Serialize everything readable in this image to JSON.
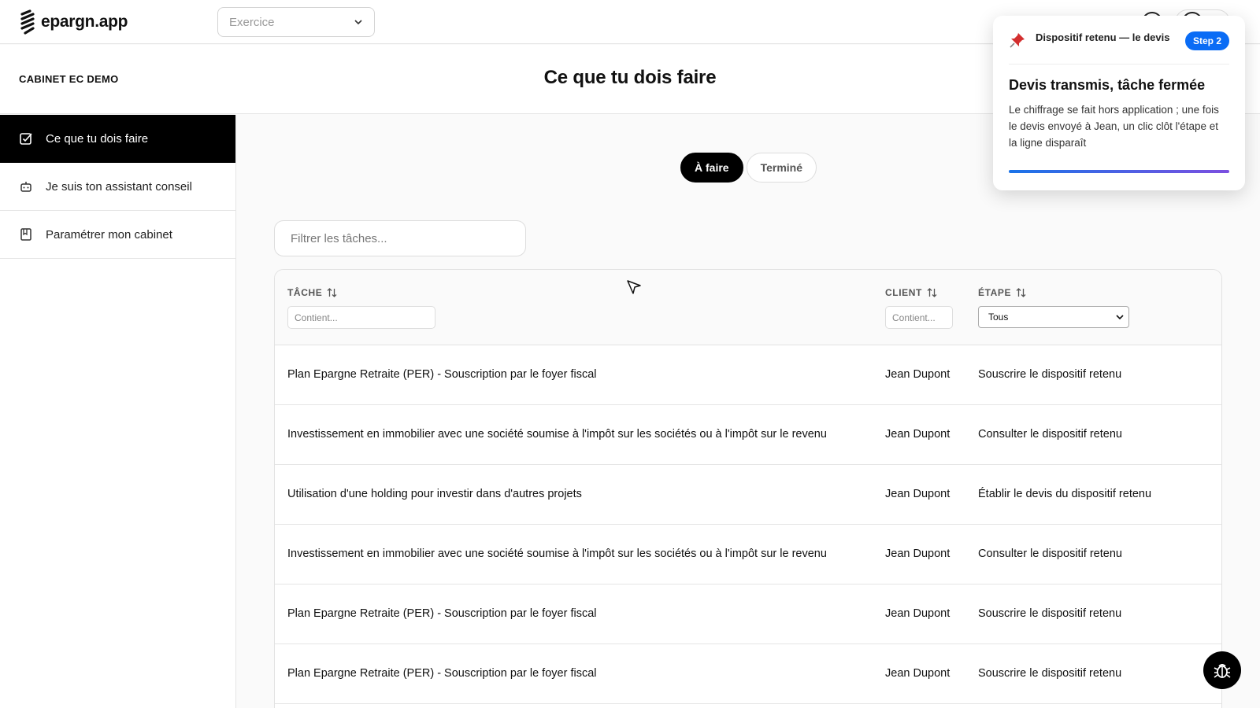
{
  "app": {
    "logo_text": "epargn.app",
    "exercise_placeholder": "Exercice"
  },
  "header": {
    "firm_name": "CABINET EC DEMO",
    "page_title": "Ce que tu dois faire"
  },
  "sidebar": {
    "items": [
      {
        "label": "Ce que tu dois faire",
        "icon": "checkbox-icon",
        "active": true
      },
      {
        "label": "Je suis ton assistant conseil",
        "icon": "robot-icon",
        "active": false
      },
      {
        "label": "Paramétrer mon cabinet",
        "icon": "book-icon",
        "active": false
      }
    ]
  },
  "tabs": {
    "todo": "À faire",
    "done": "Terminé"
  },
  "filter": {
    "placeholder": "Filtrer les tâches..."
  },
  "table": {
    "headers": {
      "task": "TÂCHE",
      "client": "CLIENT",
      "step": "ÉTAPE"
    },
    "filters": {
      "task_placeholder": "Contient...",
      "client_placeholder": "Contient...",
      "step_value": "Tous"
    },
    "rows": [
      {
        "task": "Plan Epargne Retraite (PER) - Souscription par le foyer fiscal",
        "client": "Jean Dupont",
        "step": "Souscrire le dispositif retenu"
      },
      {
        "task": "Investissement en immobilier avec une société soumise à l'impôt sur les sociétés ou à l'impôt sur le revenu",
        "client": "Jean Dupont",
        "step": "Consulter le dispositif retenu"
      },
      {
        "task": "Utilisation d'une holding pour investir dans d'autres projets",
        "client": "Jean Dupont",
        "step": "Établir le devis du dispositif retenu"
      },
      {
        "task": "Investissement en immobilier avec une société soumise à l'impôt sur les sociétés ou à l'impôt sur le revenu",
        "client": "Jean Dupont",
        "step": "Consulter le dispositif retenu"
      },
      {
        "task": "Plan Epargne Retraite (PER) - Souscription par le foyer fiscal",
        "client": "Jean Dupont",
        "step": "Souscrire le dispositif retenu"
      },
      {
        "task": "Plan Epargne Retraite (PER) - Souscription par le foyer fiscal",
        "client": "Jean Dupont",
        "step": "Souscrire le dispositif retenu"
      }
    ]
  },
  "tour": {
    "label": "Dispositif retenu — le devis",
    "step": "Step 2",
    "title": "Devis transmis, tâche fermée",
    "body": "Le chiffrage se fait hors application ; une fois le devis envoyé à Jean, un clic clôt l'étape et la ligne disparaît",
    "accent_color": "#0a6cf5"
  }
}
